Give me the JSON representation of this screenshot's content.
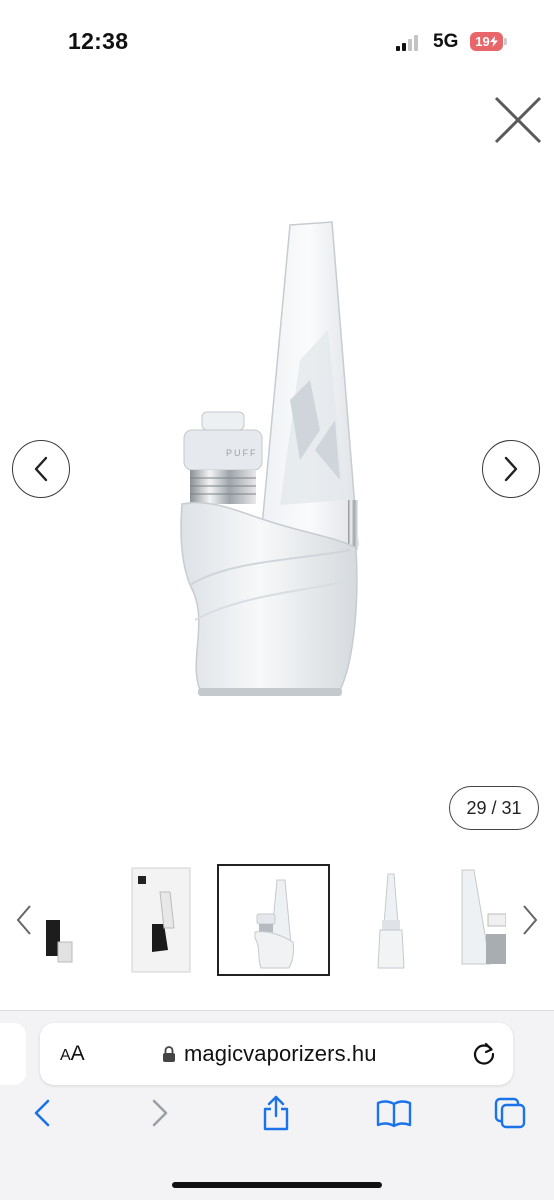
{
  "status_bar": {
    "time": "12:38",
    "network": "5G",
    "battery": "19"
  },
  "gallery": {
    "counter": "29 / 31",
    "close_icon": "close-icon",
    "prev_icon": "chevron-left-icon",
    "next_icon": "chevron-right-icon",
    "product_brand_text": "PUFF"
  },
  "thumbnails": {
    "items": [
      "thumbnail-1",
      "thumbnail-2",
      "thumbnail-3",
      "thumbnail-4",
      "thumbnail-5"
    ],
    "selected_index": 2
  },
  "browser": {
    "aa_label_small": "A",
    "aa_label_large": "A",
    "url": "magicvaporizers.hu",
    "accent_color": "#1a73e8",
    "icons": [
      "back-icon",
      "forward-icon",
      "share-icon",
      "bookmarks-icon",
      "tabs-icon"
    ]
  }
}
